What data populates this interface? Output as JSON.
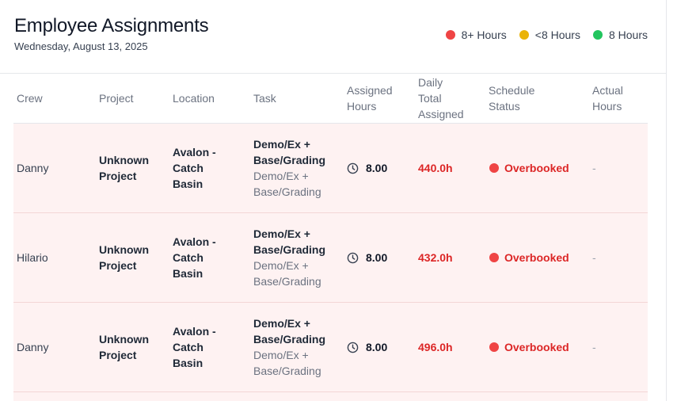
{
  "header": {
    "title": "Employee Assignments",
    "date": "Wednesday, August 13, 2025"
  },
  "legend": [
    {
      "label": "8+ Hours",
      "color": "#ef4444"
    },
    {
      "label": "<8 Hours",
      "color": "#eab308"
    },
    {
      "label": "8 Hours",
      "color": "#22c55e"
    }
  ],
  "columns": {
    "crew": "Crew",
    "project": "Project",
    "location": "Location",
    "task": "Task",
    "assigned_1": "Assigned",
    "assigned_2": "Hours",
    "daily_1": "Daily",
    "daily_2": "Total",
    "daily_3": "Assigned",
    "status_1": "Schedule",
    "status_2": "Status",
    "actual_1": "Actual",
    "actual_2": "Hours"
  },
  "rows": [
    {
      "crew": "Danny",
      "project_1": "Unknown",
      "project_2": "Project",
      "location_1": "Avalon -",
      "location_2": "Catch",
      "location_3": "Basin",
      "task_1": "Demo/Ex +",
      "task_2": "Base/Grading",
      "task_sub_1": "Demo/Ex +",
      "task_sub_2": "Base/Grading",
      "assigned": "8.00",
      "daily_total": "440.0h",
      "status": "Overbooked",
      "actual": "-"
    },
    {
      "crew": "Hilario",
      "project_1": "Unknown",
      "project_2": "Project",
      "location_1": "Avalon -",
      "location_2": "Catch",
      "location_3": "Basin",
      "task_1": "Demo/Ex +",
      "task_2": "Base/Grading",
      "task_sub_1": "Demo/Ex +",
      "task_sub_2": "Base/Grading",
      "assigned": "8.00",
      "daily_total": "432.0h",
      "status": "Overbooked",
      "actual": "-"
    },
    {
      "crew": "Danny",
      "project_1": "Unknown",
      "project_2": "Project",
      "location_1": "Avalon -",
      "location_2": "Catch",
      "location_3": "Basin",
      "task_1": "Demo/Ex +",
      "task_2": "Base/Grading",
      "task_sub_1": "Demo/Ex +",
      "task_sub_2": "Base/Grading",
      "assigned": "8.00",
      "daily_total": "496.0h",
      "status": "Overbooked",
      "actual": "-"
    }
  ]
}
